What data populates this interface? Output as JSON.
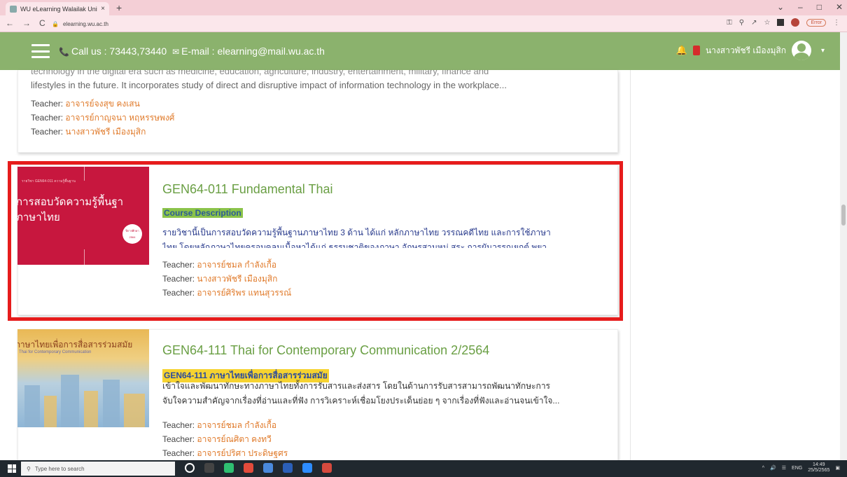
{
  "browser": {
    "tab_title": "WU eLearning Walailak Universi",
    "tab_close": "×",
    "new_tab": "+",
    "url": "elearning.wu.ac.th",
    "error_label": "Error",
    "nav": {
      "back": "←",
      "forward": "→",
      "reload": "C"
    },
    "window": {
      "chevron": "⌄",
      "minimize": "–",
      "maximize": "□",
      "close": "✕"
    }
  },
  "header": {
    "contact_text": "Call us : 73443,73440",
    "email_text": "E-mail : elearning@mail.wu.ac.th",
    "user_name": "นางสาวพัชรี เมืองมุสิก",
    "bell": "🔔",
    "caret": "▾"
  },
  "courses": [
    {
      "desc_clipped": "technology in the digital era such as medicine, education, agriculture, industry, entertainment, military, finance and",
      "desc_line": "lifestyles in the future. It incorporates study of direct and disruptive impact of information technology in the workplace...",
      "teachers": [
        {
          "label": "Teacher:",
          "name": "อาจารย์จงสุข คงเสน"
        },
        {
          "label": "Teacher:",
          "name": "อาจารย์กาญจนา หฤหรรษพงศ์"
        },
        {
          "label": "Teacher:",
          "name": "นางสาวพัชรี เมืองมุสิก"
        }
      ]
    },
    {
      "thumb_top": "รายวิชา GEN64-011 ความรู้พื้นฐาน",
      "thumb_line1": "การสอบวัดความรู้พื้นฐา",
      "thumb_line2": "ภาษาไทย",
      "thumb_badge": "ปีการศึกษา 2564",
      "title": "GEN64-011 Fundamental Thai",
      "desc_label": "Course Description",
      "desc_line1": "รายวิชานี้เป็นการสอบวัดความรู้พื้นฐานภาษาไทย 3 ด้าน ได้แก่ หลักภาษาไทย วรรณคดีไทย และการใช้ภาษา",
      "desc_line2": "ไทย โดยหลักภาษาไทยครอบคลุมเนื้อหาได้แก่ ธรรมชาติของภาษา อักษรสามหมู่ สระ การผันวรรณยุกต์ พยา",
      "teachers": [
        {
          "label": "Teacher:",
          "name": "อาจารย์ชมล กำลังเกื้อ"
        },
        {
          "label": "Teacher:",
          "name": "นางสาวพัชรี เมืองมุสิก"
        },
        {
          "label": "Teacher:",
          "name": "อาจารย์ศิริพร แทนสุวรรณ์"
        }
      ]
    },
    {
      "thumb_line1": "ภาษาไทยเพื่อการสื่อสารร่วมสมัย",
      "thumb_line2": "Thai for Contemporary Communication",
      "title": "GEN64-111 Thai for Contemporary Communication 2/2564",
      "desc_label": "GEN64-111 ภาษาไทยเพื่อการสื่อสารร่วมสมัย",
      "desc_line1": "เข้าใจและพัฒนาทักษะทางภาษาไทยทั้งการรับสารและส่งสาร โดยในด้านการรับสารสามารถพัฒนาทักษะการ",
      "desc_line2": "จับใจความสำคัญจากเรื่องที่อ่านและที่ฟัง การวิเคราะห์เชื่อมโยงประเด็นย่อย ๆ จากเรื่องที่ฟังและอ่านจนเข้าใจ...",
      "teachers": [
        {
          "label": "Teacher:",
          "name": "อาจารย์ชมล กำลังเกื้อ"
        },
        {
          "label": "Teacher:",
          "name": "อาจารย์ณศิตา คงทวี"
        },
        {
          "label": "Teacher:",
          "name": "อาจารย์ปริศา ประดิษฐศร"
        }
      ]
    }
  ],
  "taskbar": {
    "search_placeholder": "Type here to search",
    "lang": "ENG",
    "time": "14:49",
    "date": "25/5/2565"
  }
}
